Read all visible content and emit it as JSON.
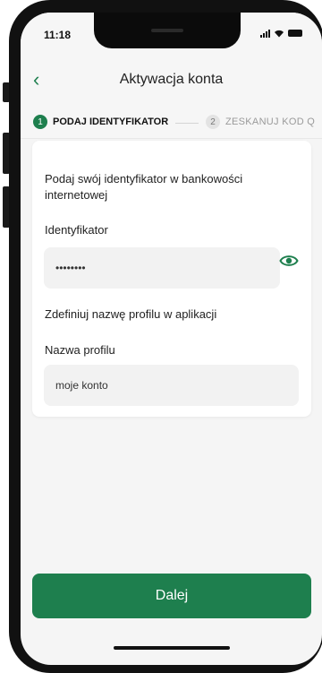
{
  "status": {
    "time": "11:18"
  },
  "header": {
    "title": "Aktywacja konta"
  },
  "stepper": {
    "steps": [
      {
        "number": "1",
        "label": "PODAJ IDENTYFIKATOR"
      },
      {
        "number": "2",
        "label": "ZESKANUJ KOD Q"
      }
    ]
  },
  "form": {
    "intro": "Podaj swój identyfikator w bankowości internetowej",
    "identifier_label": "Identyfikator",
    "identifier_value": "••••••••",
    "profile_intro": "Zdefiniuj nazwę profilu w aplikacji",
    "profile_label": "Nazwa profilu",
    "profile_value": "moje konto"
  },
  "footer": {
    "next_label": "Dalej"
  },
  "colors": {
    "accent": "#1e7f4e"
  },
  "icons": [
    "back-chevron-icon",
    "eye-icon",
    "signal-icon",
    "wifi-icon",
    "battery-icon"
  ]
}
